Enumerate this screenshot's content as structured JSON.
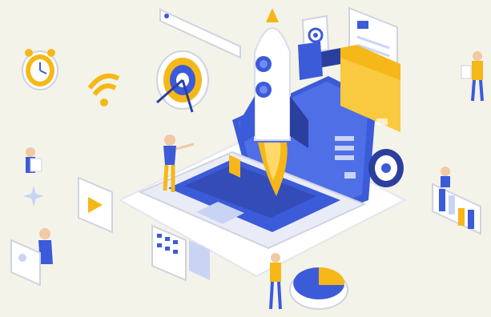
{
  "illustration": {
    "subject": "isometric-laptop-rocket-launch",
    "palette": {
      "background": "#f3f3ea",
      "primary_blue": "#3c5bd8",
      "dark_blue": "#2b3f9e",
      "light_blue": "#c9d4f5",
      "accent_yellow": "#f6b718",
      "white": "#ffffff",
      "line_gray": "#cfd3df"
    },
    "icons": [
      "alarm-clock-icon",
      "wifi-icon",
      "target-icon",
      "rocket-icon",
      "laptop-icon",
      "gear-icon",
      "folder-icon",
      "video-play-icon",
      "calculator-icon",
      "pie-chart-icon",
      "bar-chart-icon",
      "search-bar-icon",
      "document-icon"
    ]
  }
}
